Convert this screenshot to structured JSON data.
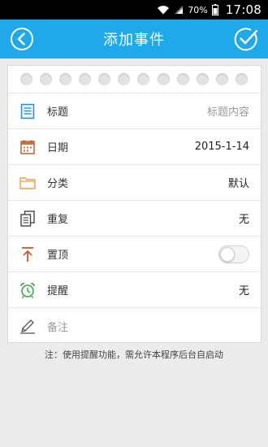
{
  "status_bar": {
    "battery": "70%",
    "time": "17:08",
    "icons": [
      "wifi-icon",
      "signal-icon",
      "battery-icon"
    ]
  },
  "header": {
    "title": "添加事件",
    "back_icon": "back-arrow-icon",
    "confirm_icon": "check-circle-icon",
    "background": "#1fa8ea"
  },
  "form": {
    "rows": [
      {
        "icon": "document-icon",
        "label": "标题",
        "value": "标题内容"
      },
      {
        "icon": "calendar-icon",
        "label": "日期",
        "value": "2015-1-14"
      },
      {
        "icon": "folder-icon",
        "label": "分类",
        "value": "默认"
      },
      {
        "icon": "copy-icon",
        "label": "重复",
        "value": "无"
      },
      {
        "icon": "pin-top-icon",
        "label": "置顶",
        "toggle": false
      },
      {
        "icon": "alarm-clock-icon",
        "label": "提醒",
        "value": "无"
      },
      {
        "icon": "pencil-icon",
        "label": "备注"
      }
    ]
  },
  "footnote": "注：使用提醒功能，需允许本程序后台自启动"
}
